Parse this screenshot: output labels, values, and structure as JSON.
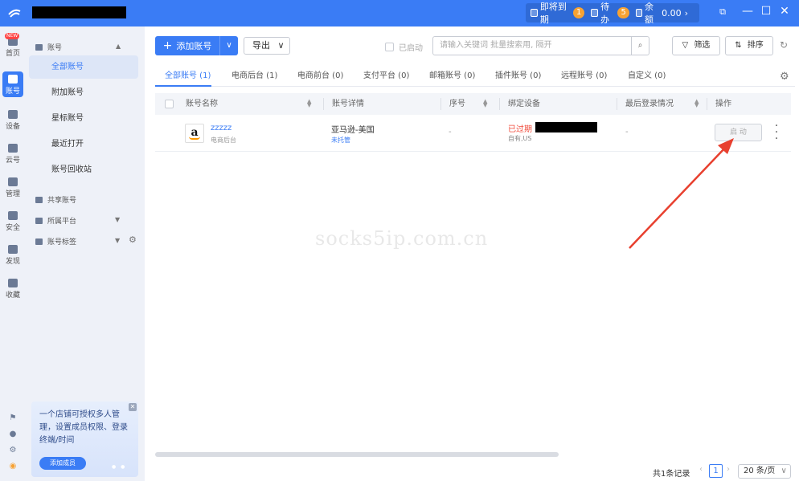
{
  "titlebar": {
    "expiring_label": "即将到期",
    "expiring_count": "1",
    "todo_label": "待办",
    "todo_count": "5",
    "balance_label": "余额",
    "balance_value": "0.00"
  },
  "rail": {
    "items": [
      {
        "label": "首页",
        "icon": "home-icon",
        "new": "NEW"
      },
      {
        "label": "账号",
        "icon": "account-icon"
      },
      {
        "label": "设备",
        "icon": "device-icon"
      },
      {
        "label": "云号",
        "icon": "cloud-icon"
      },
      {
        "label": "管理",
        "icon": "manage-icon"
      },
      {
        "label": "安全",
        "icon": "security-icon"
      },
      {
        "label": "发现",
        "icon": "discover-icon"
      },
      {
        "label": "收藏",
        "icon": "favorite-icon"
      }
    ]
  },
  "sidebar": {
    "group_accounts": "账号",
    "items": [
      "全部账号",
      "附加账号",
      "星标账号",
      "最近打开",
      "账号回收站"
    ],
    "group_shared": "共享账号",
    "group_platform": "所属平台",
    "group_tags": "账号标签",
    "promo_text": "一个店铺可授权多人管理，设置成员权限、登录终端/时间",
    "promo_button": "添加成员"
  },
  "toolbar": {
    "add_label": "添加账号",
    "export_label": "导出",
    "started_label": "已启动",
    "search_placeholder": "请输入关键词 批量搜索用, 隔开",
    "filter_label": "筛选",
    "sort_label": "排序"
  },
  "tabs": [
    "全部账号 (1)",
    "电商后台 (1)",
    "电商前台 (0)",
    "支付平台 (0)",
    "邮箱账号 (0)",
    "插件账号 (0)",
    "远程账号 (0)",
    "自定义 (0)"
  ],
  "table": {
    "headers": [
      "账号名称",
      "账号详情",
      "序号",
      "绑定设备",
      "最后登录情况",
      "操作"
    ],
    "rows": [
      {
        "name": "zzzzz",
        "type": "电商后台",
        "detail": "亚马逊-美国",
        "detail_sub": "未托管",
        "seq": "-",
        "device_status": "已过期",
        "device_sub": "自有,US",
        "last_login": "-",
        "action": "启 动"
      }
    ]
  },
  "watermark": "socks5ip.com.cn",
  "pagination": {
    "total": "共1条记录",
    "current": "1",
    "page_size": "20 条/页"
  },
  "colors": {
    "primary": "#3a7cf5",
    "expired": "#f04a3a",
    "arrow": "#e8402f"
  }
}
